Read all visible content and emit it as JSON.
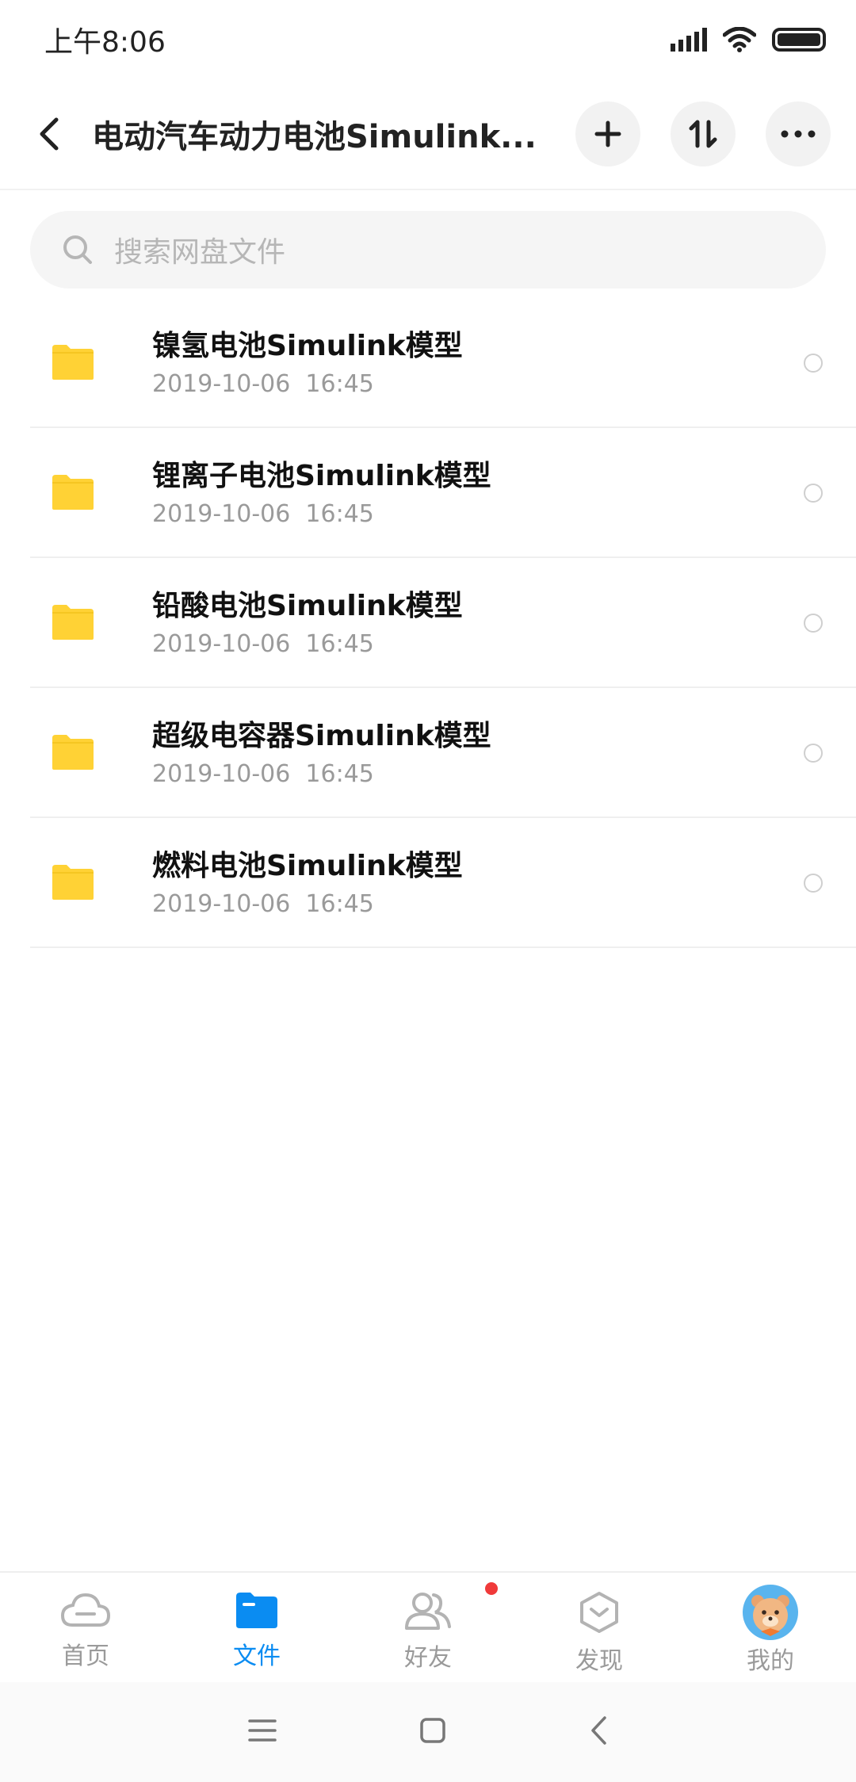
{
  "status_bar": {
    "time": "上午8:06"
  },
  "header": {
    "title": "电动汽车动力电池Simulink..."
  },
  "search": {
    "placeholder": "搜索网盘文件"
  },
  "files": [
    {
      "name": "镍氢电池Simulink模型",
      "meta": "2019-10-06  16:45"
    },
    {
      "name": "锂离子电池Simulink模型",
      "meta": "2019-10-06  16:45"
    },
    {
      "name": "铅酸电池Simulink模型",
      "meta": "2019-10-06  16:45"
    },
    {
      "name": "超级电容器Simulink模型",
      "meta": "2019-10-06  16:45"
    },
    {
      "name": "燃料电池Simulink模型",
      "meta": "2019-10-06  16:45"
    }
  ],
  "tabs": [
    {
      "label": "首页",
      "icon": "cloud-icon"
    },
    {
      "label": "文件",
      "icon": "file-folder-icon",
      "active": true
    },
    {
      "label": "好友",
      "icon": "friends-icon",
      "badge": true
    },
    {
      "label": "发现",
      "icon": "discover-icon"
    },
    {
      "label": "我的",
      "icon": "avatar-icon"
    }
  ],
  "colors": {
    "accent": "#0a8cf2",
    "folder": "#ffd235",
    "badge": "#f03a3a"
  }
}
